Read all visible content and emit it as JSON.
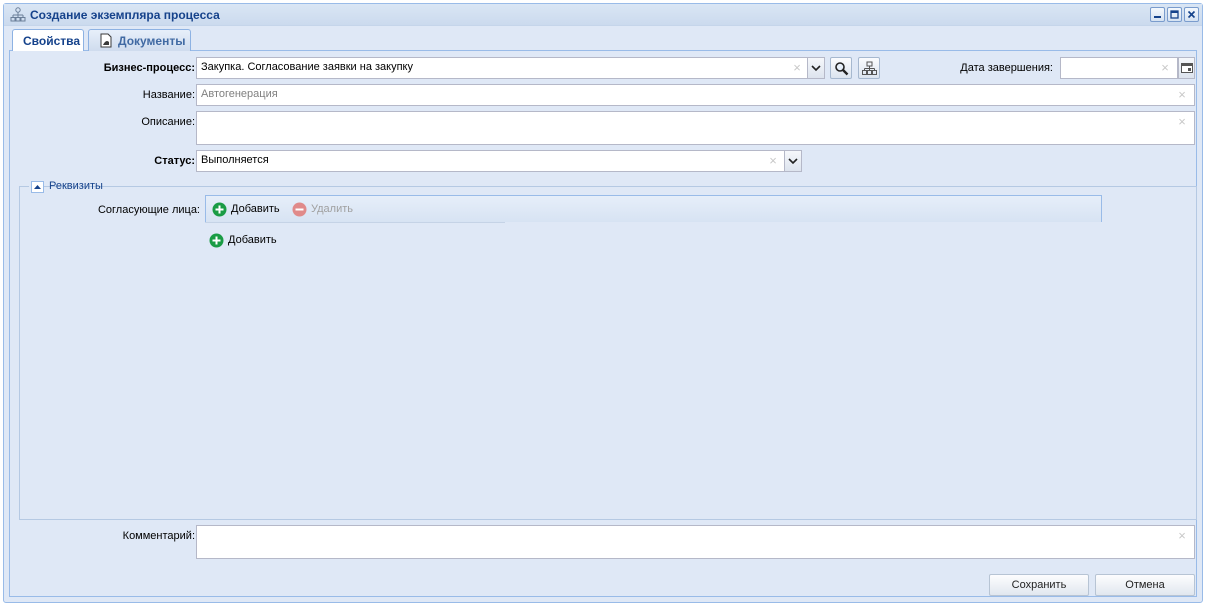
{
  "window": {
    "title": "Создание экземпляра процесса",
    "icon": "org-structure-icon",
    "controls": [
      "minimize-icon",
      "maximize-icon",
      "close-icon"
    ]
  },
  "tabs": [
    {
      "label": "Свойства",
      "active": true
    },
    {
      "label": "Документы",
      "active": false,
      "icon": "document-icon"
    }
  ],
  "form": {
    "business_process": {
      "label": "Бизнес-процесс:",
      "value": "Закупка. Согласование заявки на закупку"
    },
    "end_date": {
      "label": "Дата завершения:",
      "value": ""
    },
    "name": {
      "label": "Название:",
      "placeholder": "Автогенерация"
    },
    "description": {
      "label": "Описание:",
      "value": ""
    },
    "status": {
      "label": "Статус:",
      "value": "Выполняется"
    }
  },
  "requisites": {
    "legend": "Реквизиты",
    "approvers_label": "Согласующие лица:",
    "toolbar": {
      "add_label": "Добавить",
      "delete_label": "Удалить"
    },
    "add_below_label": "Добавить"
  },
  "comment": {
    "label": "Комментарий:",
    "value": ""
  },
  "buttons": {
    "save": "Сохранить",
    "cancel": "Отмена"
  },
  "colors": {
    "title_text": "#15428b",
    "window_bg": "#dfe8f6",
    "border": "#99bbe8",
    "add_green": "#1a9c45",
    "delete_red": "#e08a8a"
  }
}
